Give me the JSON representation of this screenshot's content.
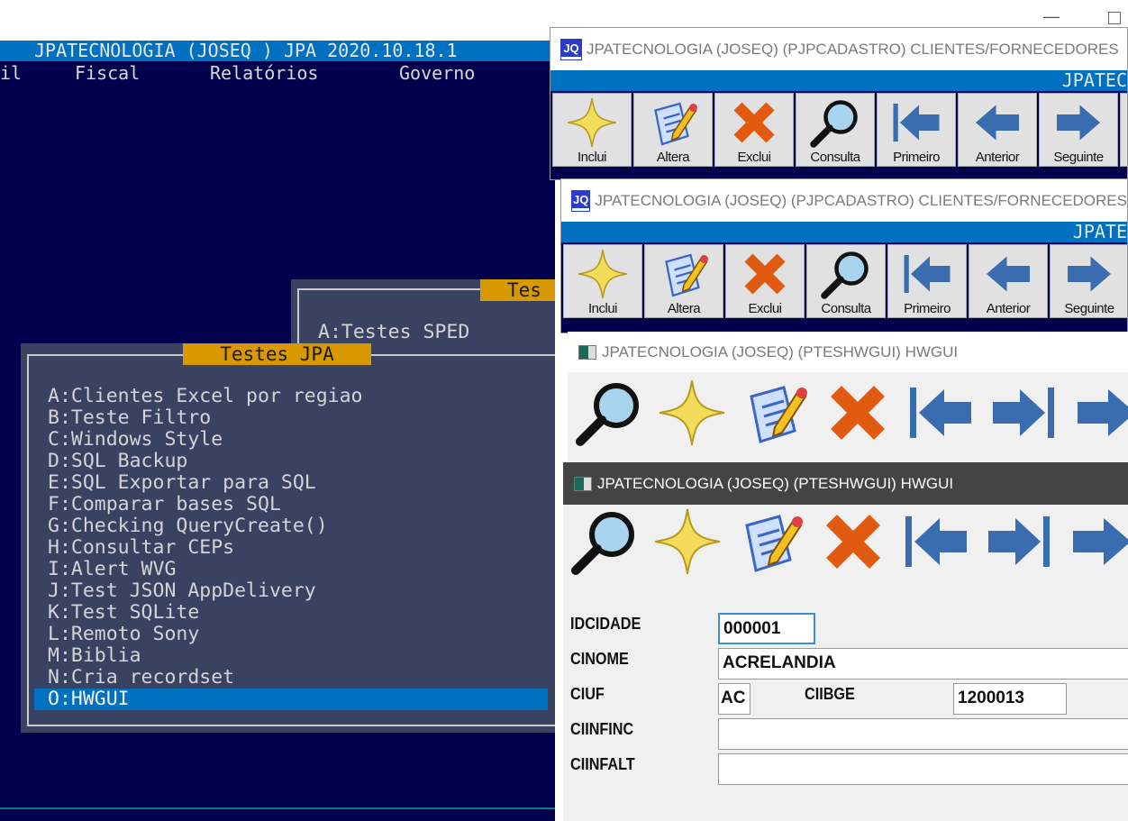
{
  "console": {
    "title": "JPATECNOLOGIA (JOSEQ ) JPA 2020.10.18.1",
    "menu": [
      "il",
      "Fiscal",
      "Relatórios",
      "Governo"
    ]
  },
  "dialog_back": {
    "title": "Tes",
    "items": [
      "A:Testes SPED"
    ]
  },
  "dialog_front": {
    "title": "Testes JPA",
    "items": [
      "A:Clientes Excel por regiao",
      "B:Teste Filtro",
      "C:Windows Style",
      "D:SQL Backup",
      "E:SQL Exportar para SQL",
      "F:Comparar bases SQL",
      "G:Checking QueryCreate()",
      "H:Consultar CEPs",
      "I:Alert WVG",
      "J:Test JSON AppDelivery",
      "K:Test SQLite",
      "L:Remoto Sony",
      "M:Biblia",
      "N:Cria recordset",
      "O:HWGUI"
    ],
    "selected": "O:HWGUI"
  },
  "desktop": {
    "minimize": "—",
    "maximize": "☐"
  },
  "windows": [
    {
      "title": "JPATECNOLOGIA (JOSEQ) (PJPCADASTRO) CLIENTES/FORNECEDORES",
      "banner": "JPATEC"
    },
    {
      "title": "JPATECNOLOGIA (JOSEQ) (PJPCADASTRO) CLIENTES/FORNECEDORES",
      "banner": "JPATE"
    },
    {
      "title": "JPATECNOLOGIA (JOSEQ) (PTESHWGUI) HWGUI"
    },
    {
      "title": "JPATECNOLOGIA (JOSEQ) (PTESHWGUI) HWGUI"
    }
  ],
  "logo_text": "JQ",
  "toolbar_labeled": [
    {
      "label": "Inclui",
      "icon": "star"
    },
    {
      "label": "Altera",
      "icon": "edit"
    },
    {
      "label": "Exclui",
      "icon": "delete"
    },
    {
      "label": "Consulta",
      "icon": "search"
    },
    {
      "label": "Primeiro",
      "icon": "first"
    },
    {
      "label": "Anterior",
      "icon": "prev"
    },
    {
      "label": "Seguinte",
      "icon": "next"
    }
  ],
  "toolbar_icons": [
    "search",
    "star",
    "edit",
    "delete",
    "first",
    "last",
    "next"
  ],
  "form": {
    "idcidade_label": "IDCIDADE",
    "idcidade": "000001",
    "cinome_label": "CINOME",
    "cinome": "ACRELANDIA",
    "ciuf_label": "CIUF",
    "ciuf": "AC",
    "ciibge_label": "CIIBGE",
    "ciibge": "1200013",
    "ciinfinc_label": "CIINFINC",
    "ciinfinc": "",
    "ciinfalt_label": "CIINFALT",
    "ciinfalt": ""
  }
}
